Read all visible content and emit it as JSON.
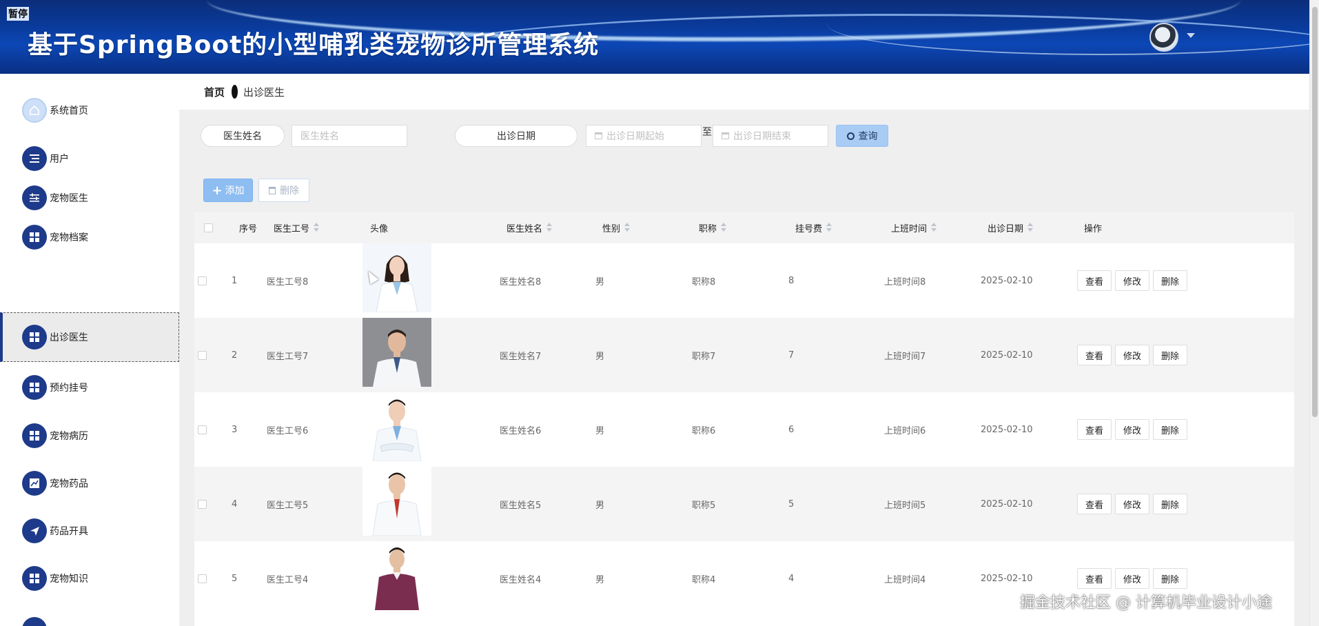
{
  "header": {
    "pause_label": "暂停",
    "title": "基于SpringBoot的小型哺乳类宠物诊所管理系统"
  },
  "breadcrumb": {
    "home": "首页",
    "current": "出诊医生"
  },
  "sidebar": {
    "items": [
      {
        "label": "系统首页",
        "icon": "home-icon"
      },
      {
        "label": "用户",
        "icon": "list-icon"
      },
      {
        "label": "宠物医生",
        "icon": "sliders-icon"
      },
      {
        "label": "宠物档案",
        "icon": "grid-icon"
      },
      {
        "label": "出诊医生",
        "icon": "grid-icon",
        "active": true
      },
      {
        "label": "预约挂号",
        "icon": "grid-icon"
      },
      {
        "label": "宠物病历",
        "icon": "grid-icon"
      },
      {
        "label": "宠物药品",
        "icon": "chart-icon"
      },
      {
        "label": "药品开具",
        "icon": "send-icon"
      },
      {
        "label": "宠物知识",
        "icon": "grid-icon"
      }
    ]
  },
  "search": {
    "name_label": "医生姓名",
    "name_placeholder": "医生姓名",
    "date_label": "出诊日期",
    "date_start_placeholder": "出诊日期起始",
    "to_text": "至",
    "date_end_placeholder": "出诊日期结束",
    "query_label": "查询"
  },
  "actions": {
    "add_label": "添加",
    "delete_label": "删除"
  },
  "table": {
    "columns": {
      "index": "序号",
      "doctor_id": "医生工号",
      "avatar": "头像",
      "doctor_name": "医生姓名",
      "gender": "性别",
      "title": "职称",
      "fee": "挂号费",
      "work_time": "上班时间",
      "visit_date": "出诊日期",
      "ops": "操作"
    },
    "rows": [
      {
        "index": "1",
        "doctor_id": "医生工号8",
        "doctor_name": "医生姓名8",
        "gender": "男",
        "title": "职称8",
        "fee": "8",
        "work_time": "上班时间8",
        "visit_date": "2025-02-10",
        "photo": "female-doctor"
      },
      {
        "index": "2",
        "doctor_id": "医生工号7",
        "doctor_name": "医生姓名7",
        "gender": "男",
        "title": "职称7",
        "fee": "7",
        "work_time": "上班时间7",
        "visit_date": "2025-02-10",
        "photo": "male-doctor-gray"
      },
      {
        "index": "3",
        "doctor_id": "医生工号6",
        "doctor_name": "医生姓名6",
        "gender": "男",
        "title": "职称6",
        "fee": "6",
        "work_time": "上班时间6",
        "visit_date": "2025-02-10",
        "photo": "male-doctor-arms"
      },
      {
        "index": "4",
        "doctor_id": "医生工号5",
        "doctor_name": "医生姓名5",
        "gender": "男",
        "title": "职称5",
        "fee": "5",
        "work_time": "上班时间5",
        "visit_date": "2025-02-10",
        "photo": "male-doctor-tie"
      },
      {
        "index": "5",
        "doctor_id": "医生工号4",
        "doctor_name": "医生姓名4",
        "gender": "男",
        "title": "职称4",
        "fee": "4",
        "work_time": "上班时间4",
        "visit_date": "2025-02-10",
        "photo": "male-sweater"
      }
    ],
    "row_actions": {
      "view": "查看",
      "edit": "修改",
      "delete": "删除"
    }
  },
  "watermark": "掘金技术社区 @ 计算机毕业设计小途",
  "colors": {
    "header_blue": "#0a3a9a",
    "sidebar_icon": "#1e3a8a",
    "primary_button": "#8ebdf2"
  }
}
